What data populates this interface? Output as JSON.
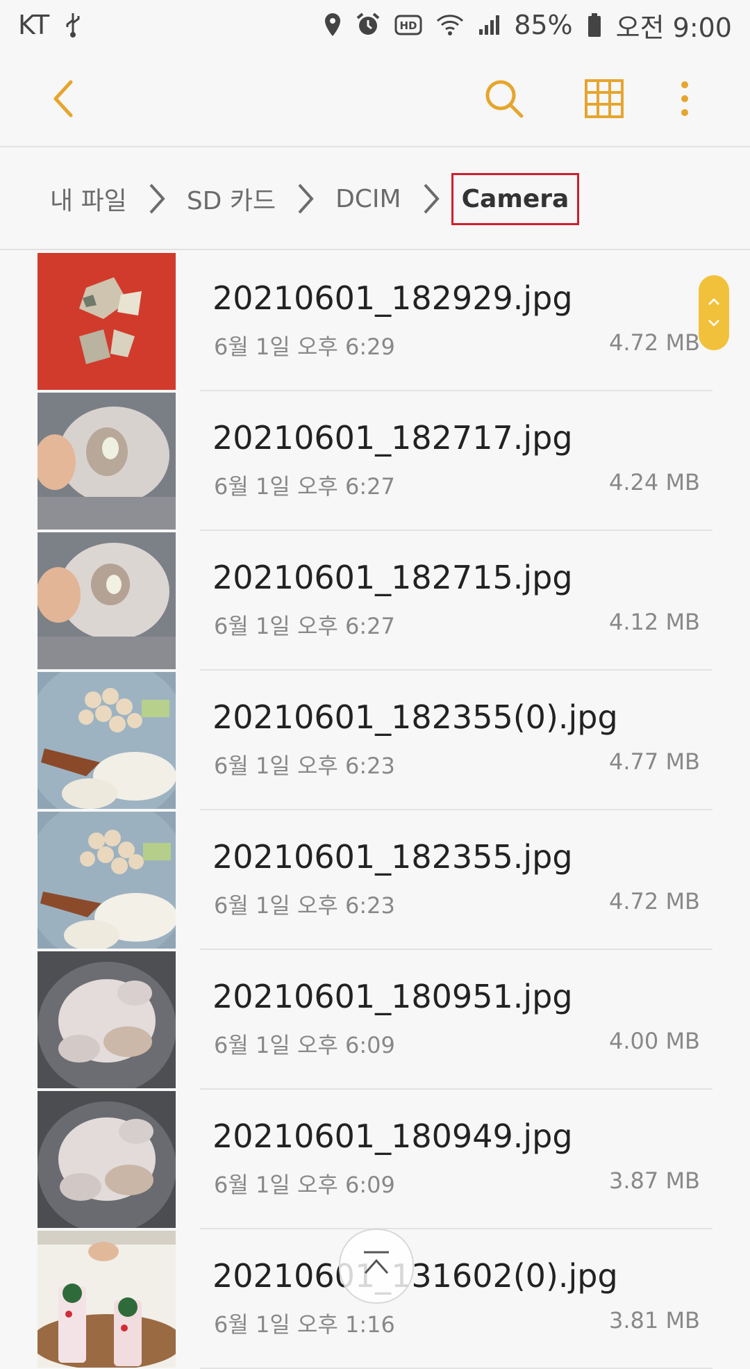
{
  "status_bar": {
    "carrier": "KT",
    "battery": "85%",
    "time": "오전 9:00",
    "icons": [
      "usb-icon",
      "location-icon",
      "alarm-icon",
      "hd-icon",
      "wifi-icon",
      "signal-icon",
      "battery-icon"
    ]
  },
  "toolbar": {
    "icons": [
      "back-icon",
      "search-icon",
      "grid-view-icon",
      "more-options-icon"
    ],
    "accent_color": "#e6a52e"
  },
  "breadcrumb": {
    "items": [
      "내 파일",
      "SD 카드",
      "DCIM",
      "Camera"
    ],
    "highlight_color": "#d01e2e"
  },
  "files": [
    {
      "name": "20210601_182929.jpg",
      "date": "6월 1일 오후 6:29",
      "size": "4.72 MB"
    },
    {
      "name": "20210601_182717.jpg",
      "date": "6월 1일 오후 6:27",
      "size": "4.24 MB"
    },
    {
      "name": "20210601_182715.jpg",
      "date": "6월 1일 오후 6:27",
      "size": "4.12 MB"
    },
    {
      "name": "20210601_182355(0).jpg",
      "date": "6월 1일 오후 6:23",
      "size": "4.77 MB"
    },
    {
      "name": "20210601_182355.jpg",
      "date": "6월 1일 오후 6:23",
      "size": "4.72 MB"
    },
    {
      "name": "20210601_180951.jpg",
      "date": "6월 1일 오후 6:09",
      "size": "4.00 MB"
    },
    {
      "name": "20210601_180949.jpg",
      "date": "6월 1일 오후 6:09",
      "size": "3.87 MB"
    },
    {
      "name": "20210601_131602(0).jpg",
      "date": "6월 1일 오후 1:16",
      "size": "3.81 MB"
    }
  ]
}
